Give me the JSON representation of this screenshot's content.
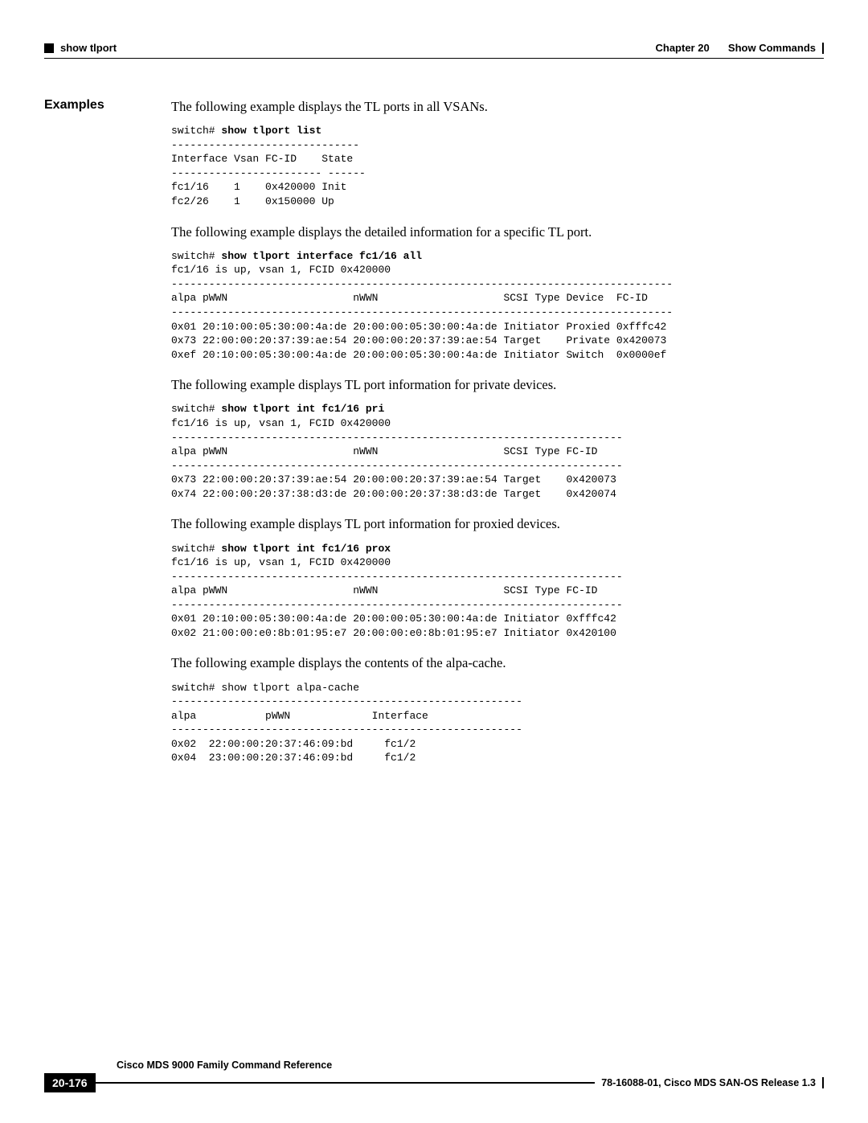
{
  "header": {
    "left_marker": "■",
    "command_name": "show tlport",
    "chapter": "Chapter 20",
    "chapter_title": "Show Commands"
  },
  "section_label": "Examples",
  "para1": "The following example displays the TL ports in all VSANs.",
  "code1_prompt": "switch# ",
  "code1_cmd": "show tlport list",
  "code1_body": "------------------------------\nInterface Vsan FC-ID    State \n------------------------ ------\nfc1/16    1    0x420000 Init \nfc2/26    1    0x150000 Up",
  "para2": "The following example displays the detailed information for a specific TL port.",
  "code2_prompt": "switch# ",
  "code2_cmd": "show tlport interface fc1/16 all",
  "code2_body": "fc1/16 is up, vsan 1, FCID 0x420000\n--------------------------------------------------------------------------------\nalpa pWWN                    nWWN                    SCSI Type Device  FC-ID \n--------------------------------------------------------------------------------\n0x01 20:10:00:05:30:00:4a:de 20:00:00:05:30:00:4a:de Initiator Proxied 0xfffc42\n0x73 22:00:00:20:37:39:ae:54 20:00:00:20:37:39:ae:54 Target    Private 0x420073\n0xef 20:10:00:05:30:00:4a:de 20:00:00:05:30:00:4a:de Initiator Switch  0x0000ef",
  "para3": "The following example displays TL port information for private devices.",
  "code3_prompt": "switch# ",
  "code3_cmd": "show tlport int fc1/16 pri",
  "code3_body": "fc1/16 is up, vsan 1, FCID 0x420000\n------------------------------------------------------------------------\nalpa pWWN                    nWWN                    SCSI Type FC-ID \n------------------------------------------------------------------------\n0x73 22:00:00:20:37:39:ae:54 20:00:00:20:37:39:ae:54 Target    0x420073\n0x74 22:00:00:20:37:38:d3:de 20:00:00:20:37:38:d3:de Target    0x420074",
  "para4": "The following example displays TL port information for proxied devices.",
  "code4_prompt": "switch# ",
  "code4_cmd": "show tlport int fc1/16 prox",
  "code4_body": "fc1/16 is up, vsan 1, FCID 0x420000\n------------------------------------------------------------------------\nalpa pWWN                    nWWN                    SCSI Type FC-ID \n------------------------------------------------------------------------\n0x01 20:10:00:05:30:00:4a:de 20:00:00:05:30:00:4a:de Initiator 0xfffc42\n0x02 21:00:00:e0:8b:01:95:e7 20:00:00:e0:8b:01:95:e7 Initiator 0x420100",
  "para5": "The following example displays the contents of the alpa-cache.",
  "code5_body": "switch# show tlport alpa-cache\n--------------------------------------------------------\nalpa           pWWN             Interface\n--------------------------------------------------------\n0x02  22:00:00:20:37:46:09:bd     fc1/2\n0x04  23:00:00:20:37:46:09:bd     fc1/2",
  "footer": {
    "book_title": "Cisco MDS 9000 Family Command Reference",
    "page_number": "20-176",
    "doc_id": "78-16088-01, Cisco MDS SAN-OS Release 1.3"
  }
}
